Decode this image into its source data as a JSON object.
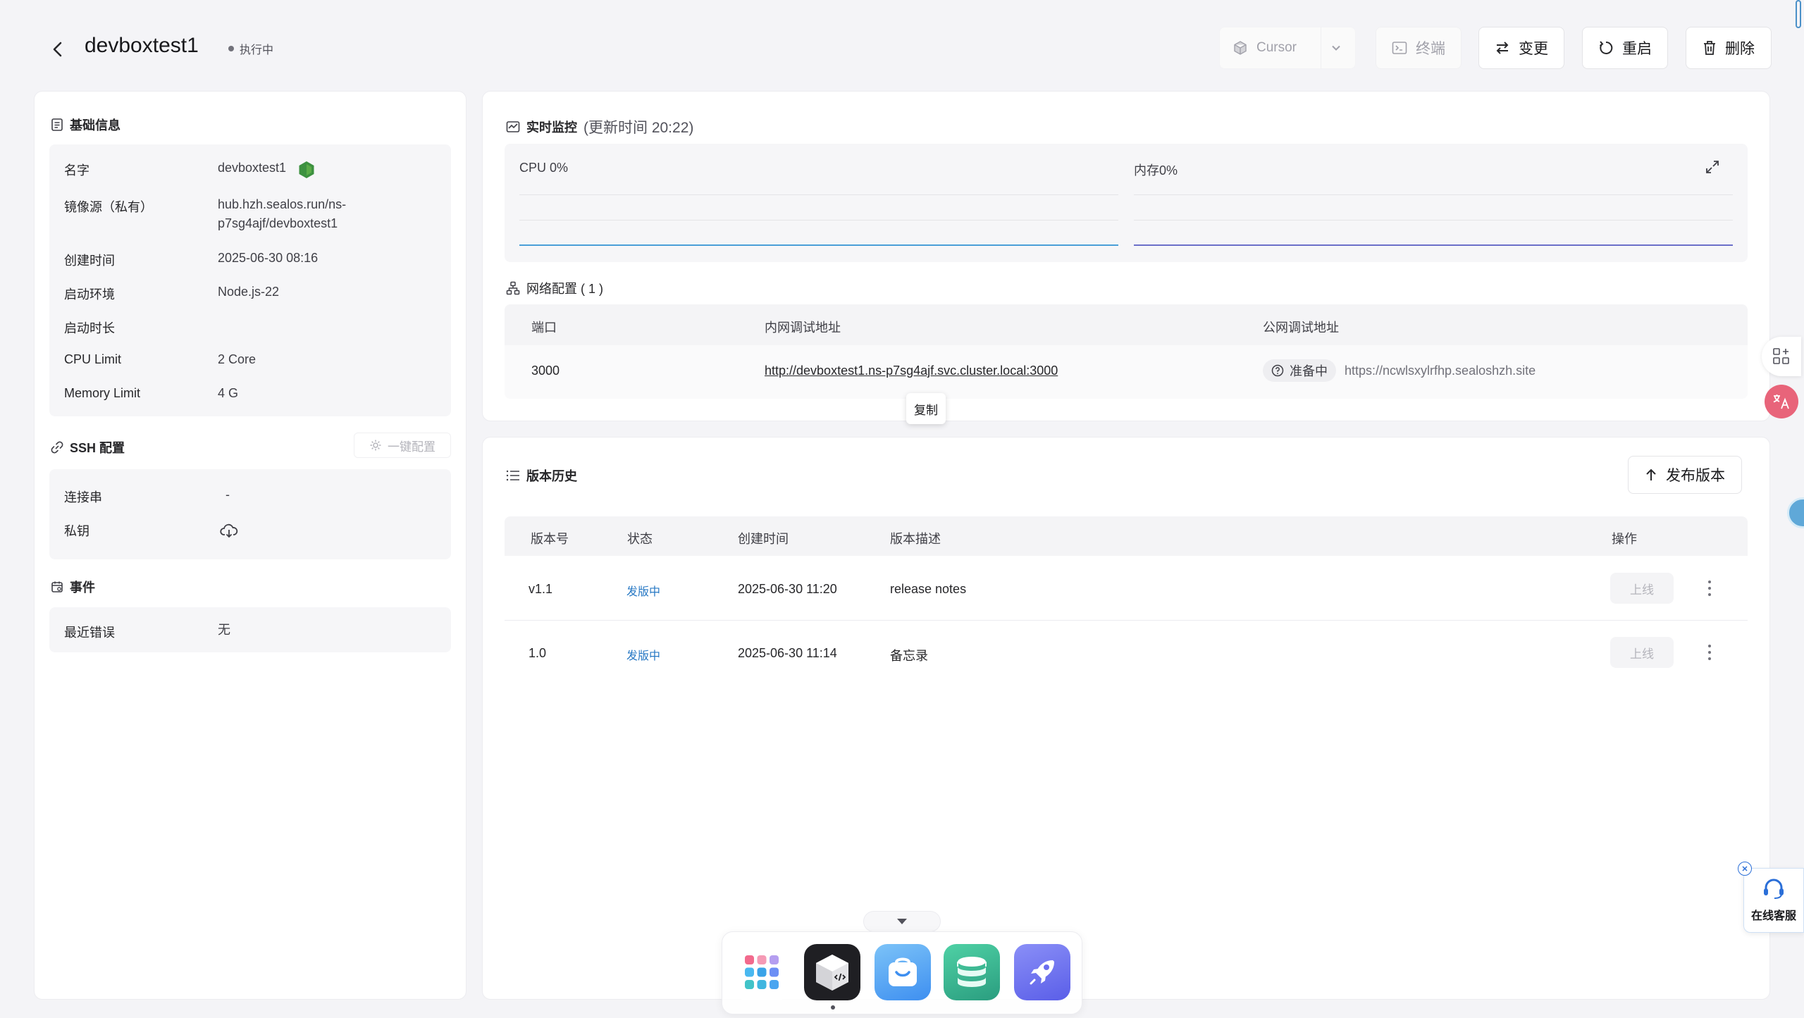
{
  "header": {
    "title": "devboxtest1",
    "status": "执行中",
    "ide_label": "Cursor",
    "terminal_label": "终端",
    "change_label": "变更",
    "restart_label": "重启",
    "delete_label": "删除"
  },
  "basic_info": {
    "title": "基础信息",
    "rows": [
      {
        "label": "名字",
        "value": "devboxtest1"
      },
      {
        "label": "镜像源（私有）",
        "value": "hub.hzh.sealos.run/ns-\np7sg4ajf/devboxtest1"
      },
      {
        "label": "创建时间",
        "value": "2025-06-30 08:16"
      },
      {
        "label": "启动环境",
        "value": "Node.js-22"
      },
      {
        "label": "启动时长",
        "value": ""
      },
      {
        "label": "CPU Limit",
        "value": "2 Core"
      },
      {
        "label": "Memory Limit",
        "value": "4 G"
      }
    ]
  },
  "ssh": {
    "title": "SSH 配置",
    "one_click_label": "一键配置",
    "rows": [
      {
        "label": "连接串",
        "value": "-"
      },
      {
        "label": "私钥",
        "value": ""
      }
    ]
  },
  "events": {
    "title": "事件",
    "rows": [
      {
        "label": "最近错误",
        "value": "无"
      }
    ]
  },
  "monitor": {
    "title": "实时监控",
    "update_text": "(更新时间  20:22)",
    "cpu_label": "CPU 0%",
    "mem_label": "内存0%",
    "colors": {
      "cpu": "#4a9fd8",
      "mem": "#6b6fc9"
    }
  },
  "network": {
    "title": "网络配置 ( 1 )",
    "headers": [
      "端口",
      "内网调试地址",
      "公网调试地址"
    ],
    "rows": [
      {
        "port": "3000",
        "internal": "http://devboxtest1.ns-p7sg4ajf.svc.cluster.local:3000",
        "status": "准备中",
        "public": "https://ncwlsxylrfhp.sealoshzh.site"
      }
    ],
    "tooltip": "复制"
  },
  "versions": {
    "title": "版本历史",
    "publish_label": "发布版本",
    "headers": [
      "版本号",
      "状态",
      "创建时间",
      "版本描述",
      "操作"
    ],
    "rows": [
      {
        "version": "v1.1",
        "status": "发版中",
        "created": "2025-06-30 11:20",
        "desc": "release notes",
        "action": "上线"
      },
      {
        "version": "1.0",
        "status": "发版中",
        "created": "2025-06-30 11:14",
        "desc": "备忘录",
        "action": "上线"
      }
    ]
  },
  "support": {
    "label": "在线客服"
  },
  "dock": {
    "apps": [
      {
        "icon": "app-grid-icon"
      },
      {
        "icon": "devbox-icon"
      },
      {
        "icon": "app-store-icon"
      },
      {
        "icon": "database-icon"
      },
      {
        "icon": "app-launchpad-icon"
      }
    ]
  }
}
